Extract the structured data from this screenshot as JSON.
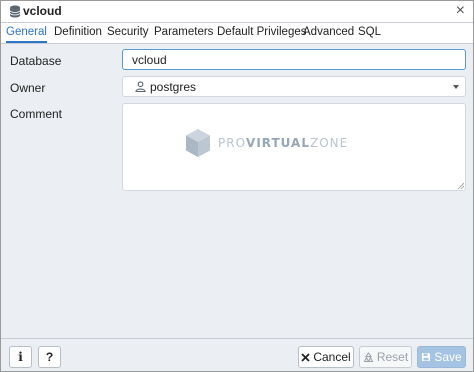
{
  "window": {
    "title": "vcloud",
    "title_icon": "database-icon",
    "close_symbol": "×"
  },
  "tabs": [
    {
      "label": "General",
      "active": true
    },
    {
      "label": "Definition",
      "active": false
    },
    {
      "label": "Security",
      "active": false
    },
    {
      "label": "Parameters",
      "active": false
    },
    {
      "label": "Default Privileges",
      "active": false
    },
    {
      "label": "Advanced",
      "active": false
    },
    {
      "label": "SQL",
      "active": false
    }
  ],
  "form": {
    "database": {
      "label": "Database",
      "value": "vcloud"
    },
    "owner": {
      "label": "Owner",
      "value": "postgres",
      "icon": "user-icon"
    },
    "comment": {
      "label": "Comment",
      "value": ""
    }
  },
  "watermark": {
    "pro": "PRO",
    "virtual": "VIRTUAL",
    "zone": "ZONE"
  },
  "footer": {
    "info_label": "i",
    "help_label": "?",
    "cancel_label": "Cancel",
    "reset_label": "Reset",
    "save_label": "Save"
  },
  "colors": {
    "accent": "#2c76c7",
    "save_button": "#a5c3e2",
    "background": "#ebeef3"
  }
}
